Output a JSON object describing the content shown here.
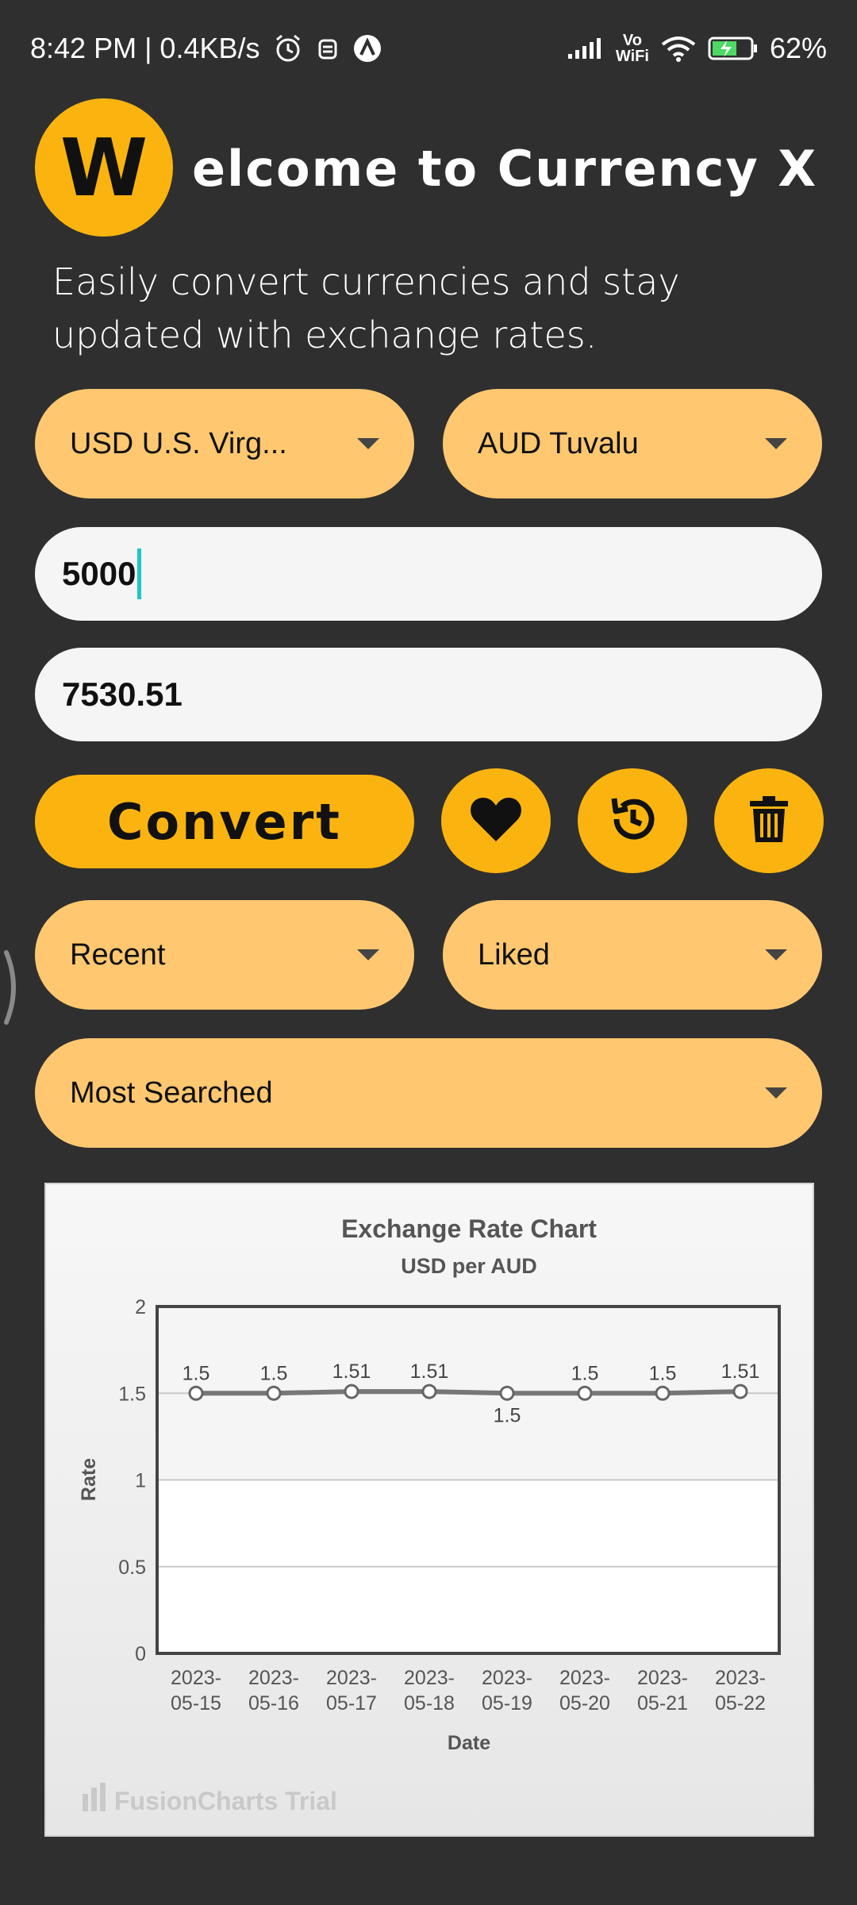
{
  "status_bar": {
    "time": "8:42 PM | 0.4KB/s",
    "vowifi_top": "Vo",
    "vowifi_bottom": "WiFi",
    "battery": "62%"
  },
  "header": {
    "logo_letter": "W",
    "title": "elcome to Currency X",
    "subtitle": "Easily convert currencies and stay updated with exchange rates."
  },
  "converter": {
    "from_currency": "USD U.S. Virg...",
    "to_currency": "AUD Tuvalu",
    "amount_value": "5000",
    "result_value": "7530.51",
    "convert_label": "Convert"
  },
  "filters": {
    "recent_label": "Recent",
    "liked_label": "Liked",
    "most_searched_label": "Most Searched"
  },
  "colors": {
    "accent": "#fbb40f",
    "dropdown_bg": "#ffc870",
    "background": "#2f2f2f"
  },
  "chart_data": {
    "type": "line",
    "title": "Exchange Rate Chart",
    "subtitle": "USD per AUD",
    "xlabel": "Date",
    "ylabel": "Rate",
    "ylim": [
      0,
      2
    ],
    "yticks": [
      "0",
      "0.5",
      "1",
      "1.5",
      "2"
    ],
    "x": [
      "2023-05-15",
      "2023-05-16",
      "2023-05-17",
      "2023-05-18",
      "2023-05-19",
      "2023-05-20",
      "2023-05-21",
      "2023-05-22"
    ],
    "values": [
      1.5,
      1.5,
      1.51,
      1.51,
      1.5,
      1.5,
      1.5,
      1.51
    ],
    "data_labels": [
      "1.5",
      "1.5",
      "1.51",
      "1.51",
      "1.5",
      "1.5",
      "1.5",
      "1.51"
    ],
    "grid": true,
    "watermark": "FusionCharts Trial"
  }
}
